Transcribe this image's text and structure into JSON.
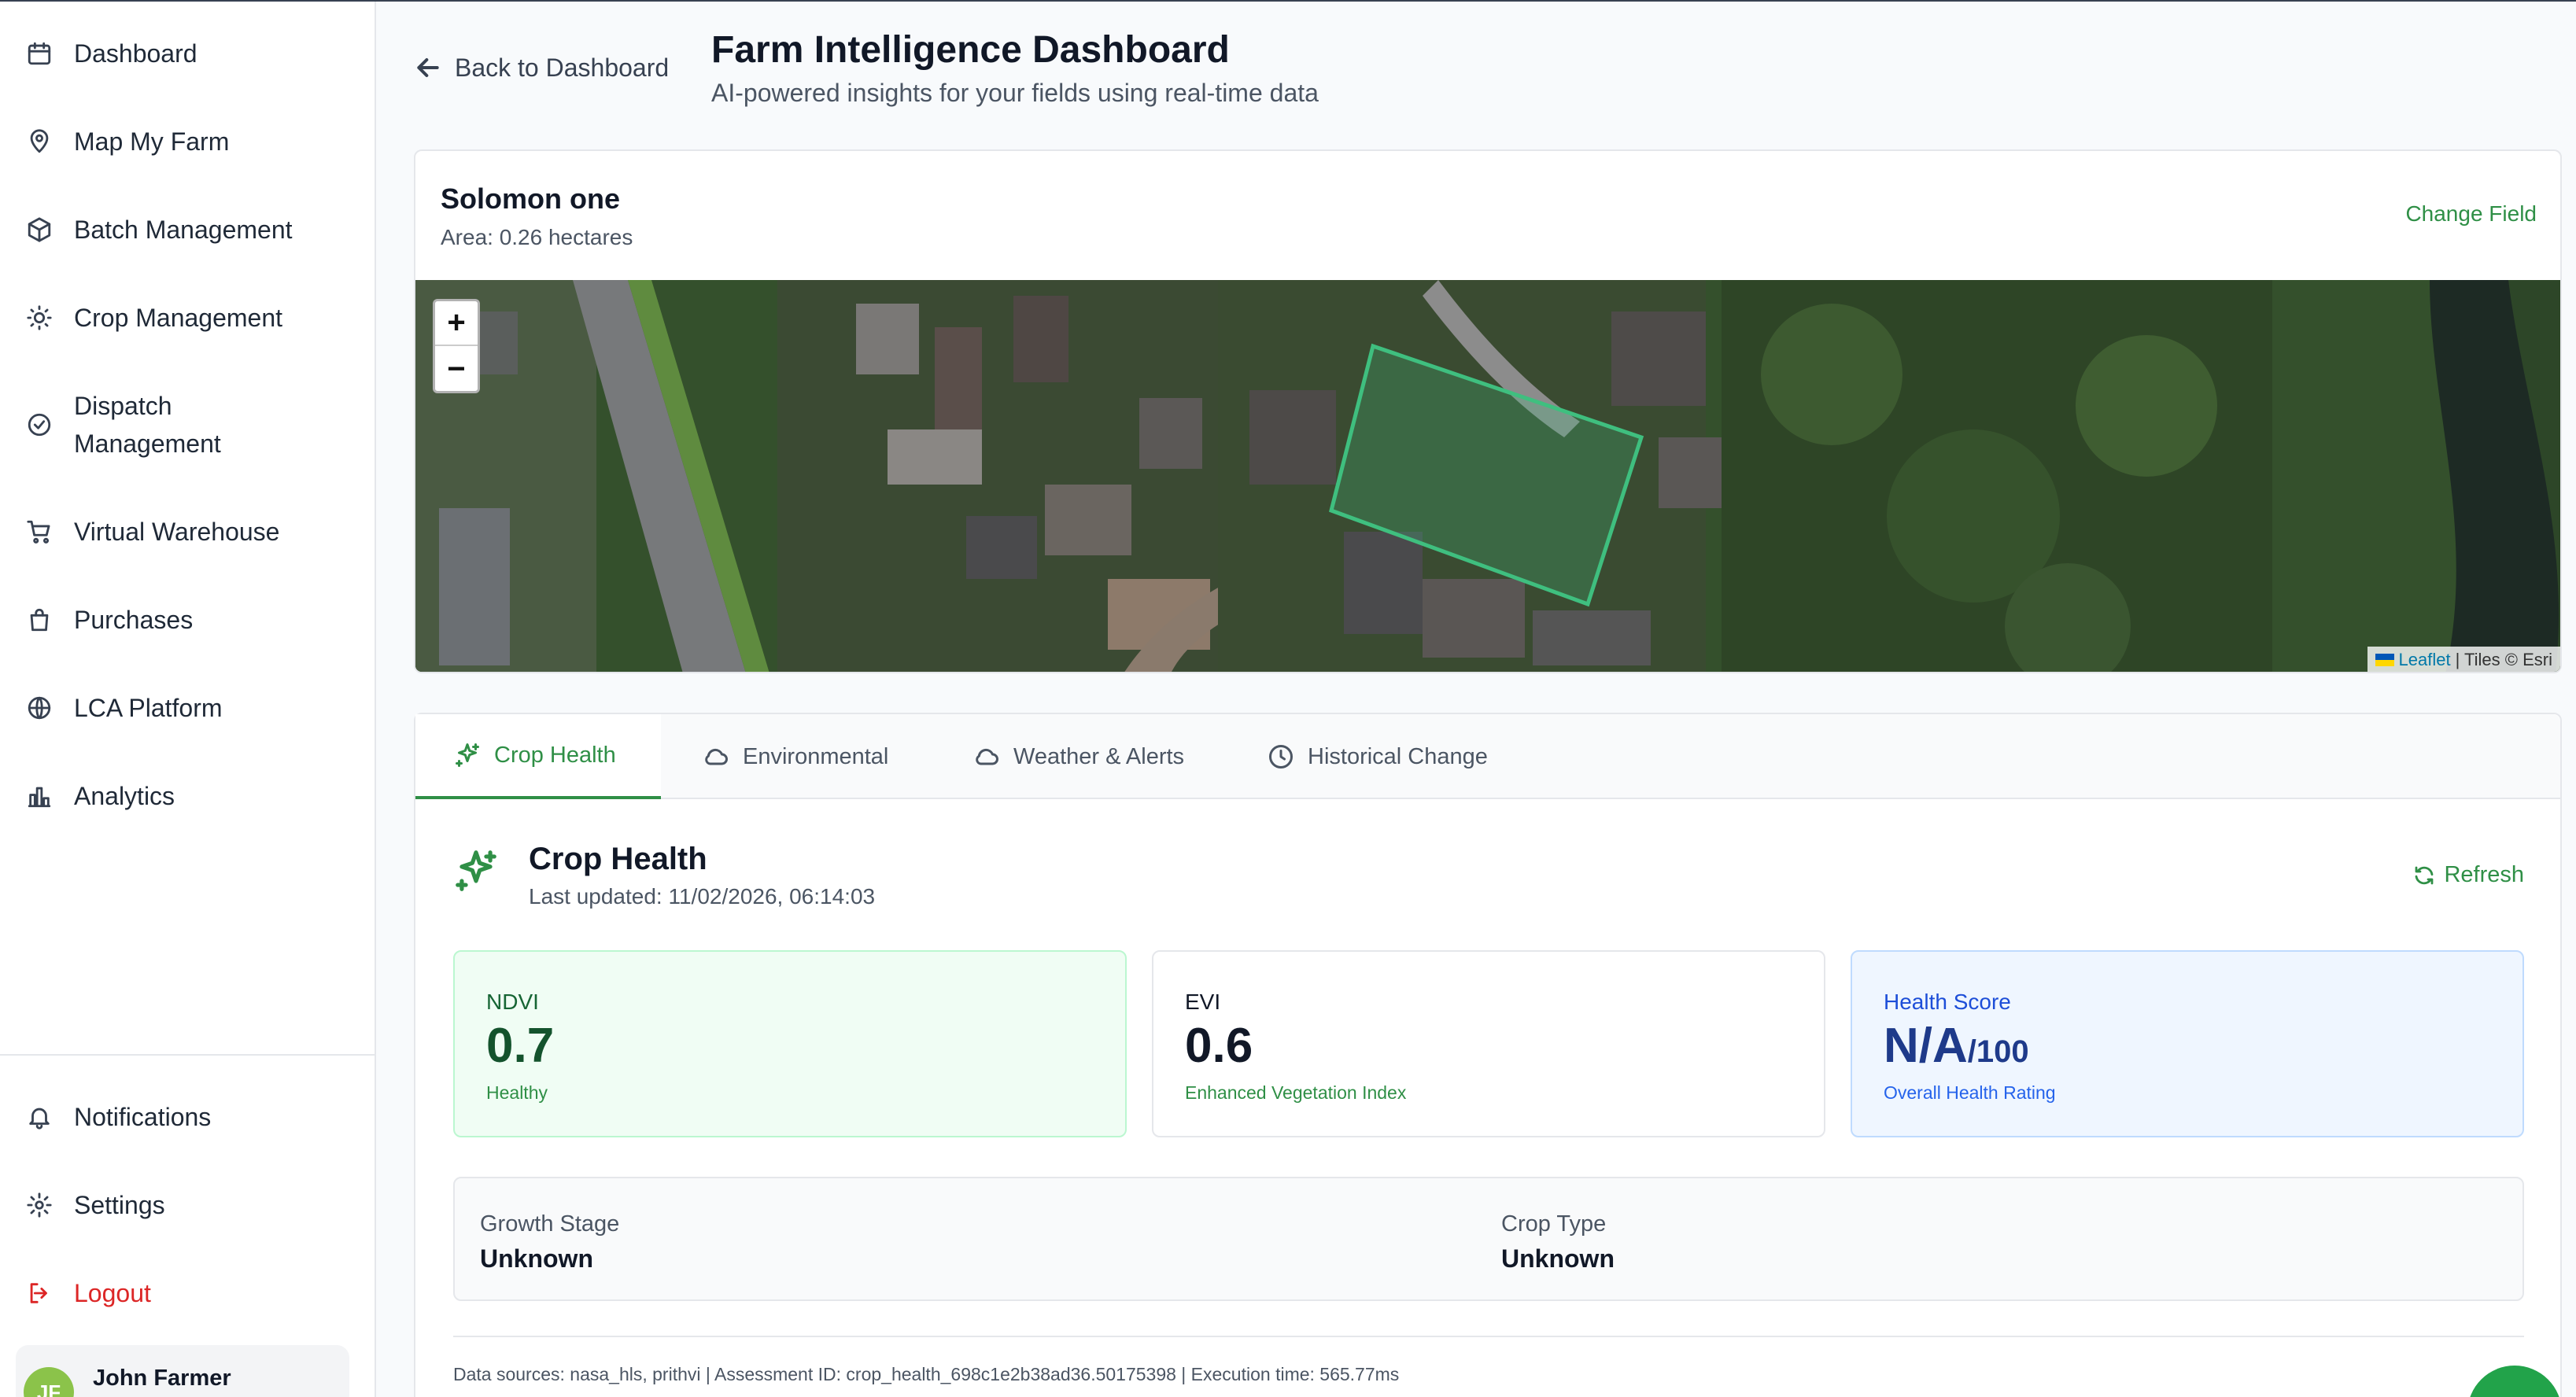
{
  "sidebar": {
    "items": [
      {
        "label": "Dashboard",
        "icon": "calendar-icon"
      },
      {
        "label": "Map My Farm",
        "icon": "map-pin-icon"
      },
      {
        "label": "Batch Management",
        "icon": "package-icon"
      },
      {
        "label": "Crop Management",
        "icon": "sun-icon"
      },
      {
        "label": "Dispatch Management",
        "icon": "check-circle-icon"
      },
      {
        "label": "Virtual Warehouse",
        "icon": "cart-icon"
      },
      {
        "label": "Purchases",
        "icon": "shopping-bag-icon"
      },
      {
        "label": "LCA Platform",
        "icon": "globe-icon"
      },
      {
        "label": "Analytics",
        "icon": "bar-chart-icon"
      }
    ],
    "bottom": {
      "notifications": "Notifications",
      "settings": "Settings",
      "logout": "Logout"
    },
    "user": {
      "initials": "JF",
      "name": "John Farmer"
    }
  },
  "header": {
    "back": "Back to Dashboard",
    "title": "Farm Intelligence Dashboard",
    "subtitle": "AI-powered insights for your fields using real-time data"
  },
  "field": {
    "name": "Solomon one",
    "area": "Area: 0.26 hectares",
    "change": "Change Field"
  },
  "map": {
    "zoom_in": "+",
    "zoom_out": "−",
    "attribution_leaflet": "Leaflet",
    "attribution_tiles": "| Tiles © Esri",
    "polygon_color": "#3fbf7f"
  },
  "tabs": [
    {
      "label": "Crop Health",
      "icon": "sparkles-icon",
      "active": true
    },
    {
      "label": "Environmental",
      "icon": "cloud-icon",
      "active": false
    },
    {
      "label": "Weather & Alerts",
      "icon": "cloud-icon",
      "active": false
    },
    {
      "label": "Historical Change",
      "icon": "clock-icon",
      "active": false
    }
  ],
  "crop_health": {
    "title": "Crop Health",
    "updated": "Last updated: 11/02/2026, 06:14:03",
    "refresh": "Refresh",
    "ndvi": {
      "label": "NDVI",
      "value": "0.7",
      "sub": "Healthy"
    },
    "evi": {
      "label": "EVI",
      "value": "0.6",
      "sub": "Enhanced Vegetation Index"
    },
    "health": {
      "label": "Health Score",
      "value": "N/A",
      "denom": "/100",
      "sub": "Overall Health Rating"
    },
    "growth_stage": {
      "label": "Growth Stage",
      "value": "Unknown"
    },
    "crop_type": {
      "label": "Crop Type",
      "value": "Unknown"
    },
    "footer": "Data sources: nasa_hls, prithvi | Assessment ID: crop_health_698c1e2b38ad36.50175398 | Execution time: 565.77ms"
  },
  "colors": {
    "accent": "#2f8f46",
    "danger": "#dc2626",
    "info": "#1d4ed8"
  }
}
